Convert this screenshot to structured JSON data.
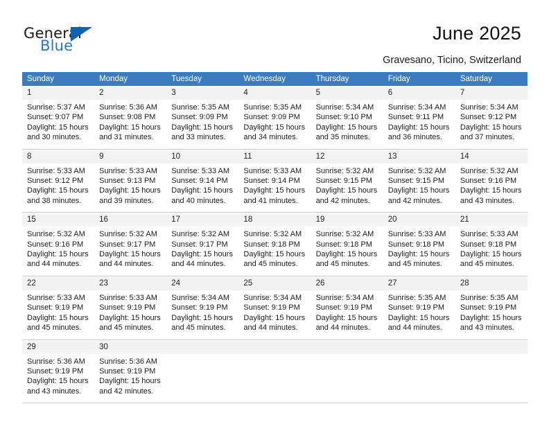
{
  "brand": {
    "name_part1": "General",
    "name_part2": "Blue",
    "triangle_color": "#1163ae",
    "blue_text_color": "#1f7ac4"
  },
  "header": {
    "title": "June 2025",
    "location": "Gravesano, Ticino, Switzerland"
  },
  "theme": {
    "header_row_bg": "#3a7cbe",
    "header_row_text": "#ffffff",
    "daynum_row_bg": "#f2f2f2",
    "cell_bg": "#ffffff",
    "grid_line": "#c8c8c8"
  },
  "day_headers": [
    "Sunday",
    "Monday",
    "Tuesday",
    "Wednesday",
    "Thursday",
    "Friday",
    "Saturday"
  ],
  "weeks": [
    {
      "days": [
        {
          "day": "1",
          "lines": [
            "Sunrise: 5:37 AM",
            "Sunset: 9:07 PM",
            "Daylight: 15 hours",
            "and 30 minutes."
          ]
        },
        {
          "day": "2",
          "lines": [
            "Sunrise: 5:36 AM",
            "Sunset: 9:08 PM",
            "Daylight: 15 hours",
            "and 31 minutes."
          ]
        },
        {
          "day": "3",
          "lines": [
            "Sunrise: 5:35 AM",
            "Sunset: 9:09 PM",
            "Daylight: 15 hours",
            "and 33 minutes."
          ]
        },
        {
          "day": "4",
          "lines": [
            "Sunrise: 5:35 AM",
            "Sunset: 9:09 PM",
            "Daylight: 15 hours",
            "and 34 minutes."
          ]
        },
        {
          "day": "5",
          "lines": [
            "Sunrise: 5:34 AM",
            "Sunset: 9:10 PM",
            "Daylight: 15 hours",
            "and 35 minutes."
          ]
        },
        {
          "day": "6",
          "lines": [
            "Sunrise: 5:34 AM",
            "Sunset: 9:11 PM",
            "Daylight: 15 hours",
            "and 36 minutes."
          ]
        },
        {
          "day": "7",
          "lines": [
            "Sunrise: 5:34 AM",
            "Sunset: 9:12 PM",
            "Daylight: 15 hours",
            "and 37 minutes."
          ]
        }
      ]
    },
    {
      "days": [
        {
          "day": "8",
          "lines": [
            "Sunrise: 5:33 AM",
            "Sunset: 9:12 PM",
            "Daylight: 15 hours",
            "and 38 minutes."
          ]
        },
        {
          "day": "9",
          "lines": [
            "Sunrise: 5:33 AM",
            "Sunset: 9:13 PM",
            "Daylight: 15 hours",
            "and 39 minutes."
          ]
        },
        {
          "day": "10",
          "lines": [
            "Sunrise: 5:33 AM",
            "Sunset: 9:14 PM",
            "Daylight: 15 hours",
            "and 40 minutes."
          ]
        },
        {
          "day": "11",
          "lines": [
            "Sunrise: 5:33 AM",
            "Sunset: 9:14 PM",
            "Daylight: 15 hours",
            "and 41 minutes."
          ]
        },
        {
          "day": "12",
          "lines": [
            "Sunrise: 5:32 AM",
            "Sunset: 9:15 PM",
            "Daylight: 15 hours",
            "and 42 minutes."
          ]
        },
        {
          "day": "13",
          "lines": [
            "Sunrise: 5:32 AM",
            "Sunset: 9:15 PM",
            "Daylight: 15 hours",
            "and 42 minutes."
          ]
        },
        {
          "day": "14",
          "lines": [
            "Sunrise: 5:32 AM",
            "Sunset: 9:16 PM",
            "Daylight: 15 hours",
            "and 43 minutes."
          ]
        }
      ]
    },
    {
      "days": [
        {
          "day": "15",
          "lines": [
            "Sunrise: 5:32 AM",
            "Sunset: 9:16 PM",
            "Daylight: 15 hours",
            "and 44 minutes."
          ]
        },
        {
          "day": "16",
          "lines": [
            "Sunrise: 5:32 AM",
            "Sunset: 9:17 PM",
            "Daylight: 15 hours",
            "and 44 minutes."
          ]
        },
        {
          "day": "17",
          "lines": [
            "Sunrise: 5:32 AM",
            "Sunset: 9:17 PM",
            "Daylight: 15 hours",
            "and 44 minutes."
          ]
        },
        {
          "day": "18",
          "lines": [
            "Sunrise: 5:32 AM",
            "Sunset: 9:18 PM",
            "Daylight: 15 hours",
            "and 45 minutes."
          ]
        },
        {
          "day": "19",
          "lines": [
            "Sunrise: 5:32 AM",
            "Sunset: 9:18 PM",
            "Daylight: 15 hours",
            "and 45 minutes."
          ]
        },
        {
          "day": "20",
          "lines": [
            "Sunrise: 5:33 AM",
            "Sunset: 9:18 PM",
            "Daylight: 15 hours",
            "and 45 minutes."
          ]
        },
        {
          "day": "21",
          "lines": [
            "Sunrise: 5:33 AM",
            "Sunset: 9:18 PM",
            "Daylight: 15 hours",
            "and 45 minutes."
          ]
        }
      ]
    },
    {
      "days": [
        {
          "day": "22",
          "lines": [
            "Sunrise: 5:33 AM",
            "Sunset: 9:19 PM",
            "Daylight: 15 hours",
            "and 45 minutes."
          ]
        },
        {
          "day": "23",
          "lines": [
            "Sunrise: 5:33 AM",
            "Sunset: 9:19 PM",
            "Daylight: 15 hours",
            "and 45 minutes."
          ]
        },
        {
          "day": "24",
          "lines": [
            "Sunrise: 5:34 AM",
            "Sunset: 9:19 PM",
            "Daylight: 15 hours",
            "and 45 minutes."
          ]
        },
        {
          "day": "25",
          "lines": [
            "Sunrise: 5:34 AM",
            "Sunset: 9:19 PM",
            "Daylight: 15 hours",
            "and 44 minutes."
          ]
        },
        {
          "day": "26",
          "lines": [
            "Sunrise: 5:34 AM",
            "Sunset: 9:19 PM",
            "Daylight: 15 hours",
            "and 44 minutes."
          ]
        },
        {
          "day": "27",
          "lines": [
            "Sunrise: 5:35 AM",
            "Sunset: 9:19 PM",
            "Daylight: 15 hours",
            "and 44 minutes."
          ]
        },
        {
          "day": "28",
          "lines": [
            "Sunrise: 5:35 AM",
            "Sunset: 9:19 PM",
            "Daylight: 15 hours",
            "and 43 minutes."
          ]
        }
      ]
    },
    {
      "days": [
        {
          "day": "29",
          "lines": [
            "Sunrise: 5:36 AM",
            "Sunset: 9:19 PM",
            "Daylight: 15 hours",
            "and 43 minutes."
          ]
        },
        {
          "day": "30",
          "lines": [
            "Sunrise: 5:36 AM",
            "Sunset: 9:19 PM",
            "Daylight: 15 hours",
            "and 42 minutes."
          ]
        },
        {
          "day": "",
          "lines": []
        },
        {
          "day": "",
          "lines": []
        },
        {
          "day": "",
          "lines": []
        },
        {
          "day": "",
          "lines": []
        },
        {
          "day": "",
          "lines": []
        }
      ]
    }
  ]
}
